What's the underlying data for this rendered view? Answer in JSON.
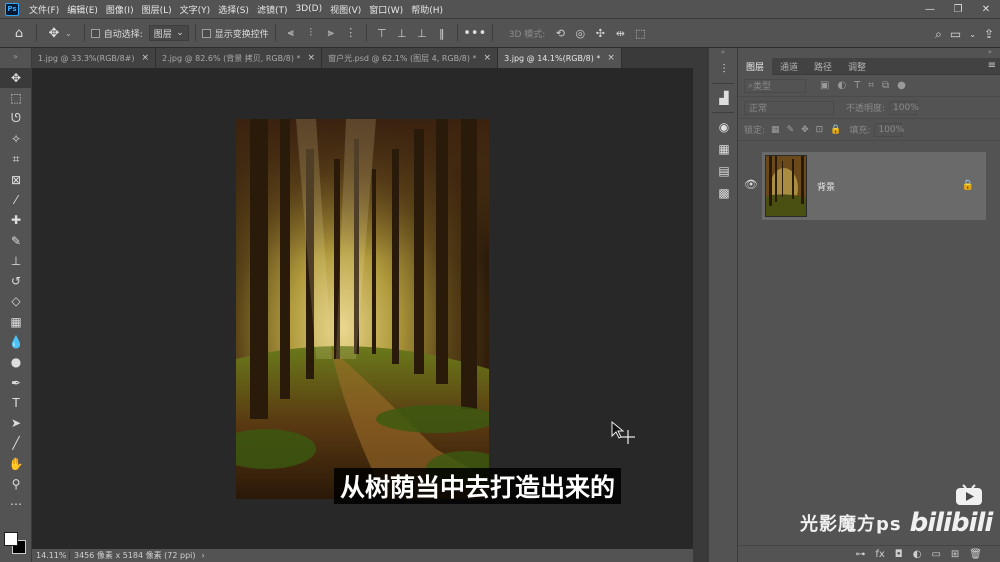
{
  "app": {
    "logo": "Ps",
    "menu": [
      "文件(F)",
      "编辑(E)",
      "图像(I)",
      "图层(L)",
      "文字(Y)",
      "选择(S)",
      "滤镜(T)",
      "3D(D)",
      "视图(V)",
      "窗口(W)",
      "帮助(H)"
    ]
  },
  "options": {
    "auto_select_label": "自动选择:",
    "auto_select_value": "图层",
    "show_transform_label": "显示变换控件",
    "mode_3d_label": "3D 模式:"
  },
  "tabs": [
    {
      "label": "1.jpg @ 33.3%(RGB/8#)",
      "close": "×"
    },
    {
      "label": "2.jpg @ 82.6% (背景 拷贝, RGB/8) *",
      "close": "×"
    },
    {
      "label": "窗户光.psd @ 62.1% (图层 4, RGB/8) *",
      "close": "×"
    },
    {
      "label": "3.jpg @ 14.1%(RGB/8) *",
      "close": "×"
    }
  ],
  "status": {
    "zoom": "14.11%",
    "dimensions": "3456 像素 x 5184 像素 (72 ppi)",
    "arrow": "›"
  },
  "layers_panel": {
    "tabs": [
      "图层",
      "通道",
      "路径",
      "调整"
    ],
    "filter_placeholder": "类型",
    "blend_mode": "正常",
    "opacity_label": "不透明度:",
    "opacity_value": "100%",
    "lock_label": "锁定:",
    "fill_label": "填充:",
    "fill_value": "100%",
    "layers": [
      {
        "name": "背景",
        "visible": true,
        "locked": true
      }
    ]
  },
  "subtitle": "从树荫当中去打造出来的",
  "watermark": {
    "channel": "光影魔方ps",
    "site_logo": "bilibili"
  },
  "colors": {
    "panel_bg": "#535353",
    "canvas_bg": "#282828",
    "active_tab": "#535353",
    "ps_blue": "#31a8ff"
  }
}
